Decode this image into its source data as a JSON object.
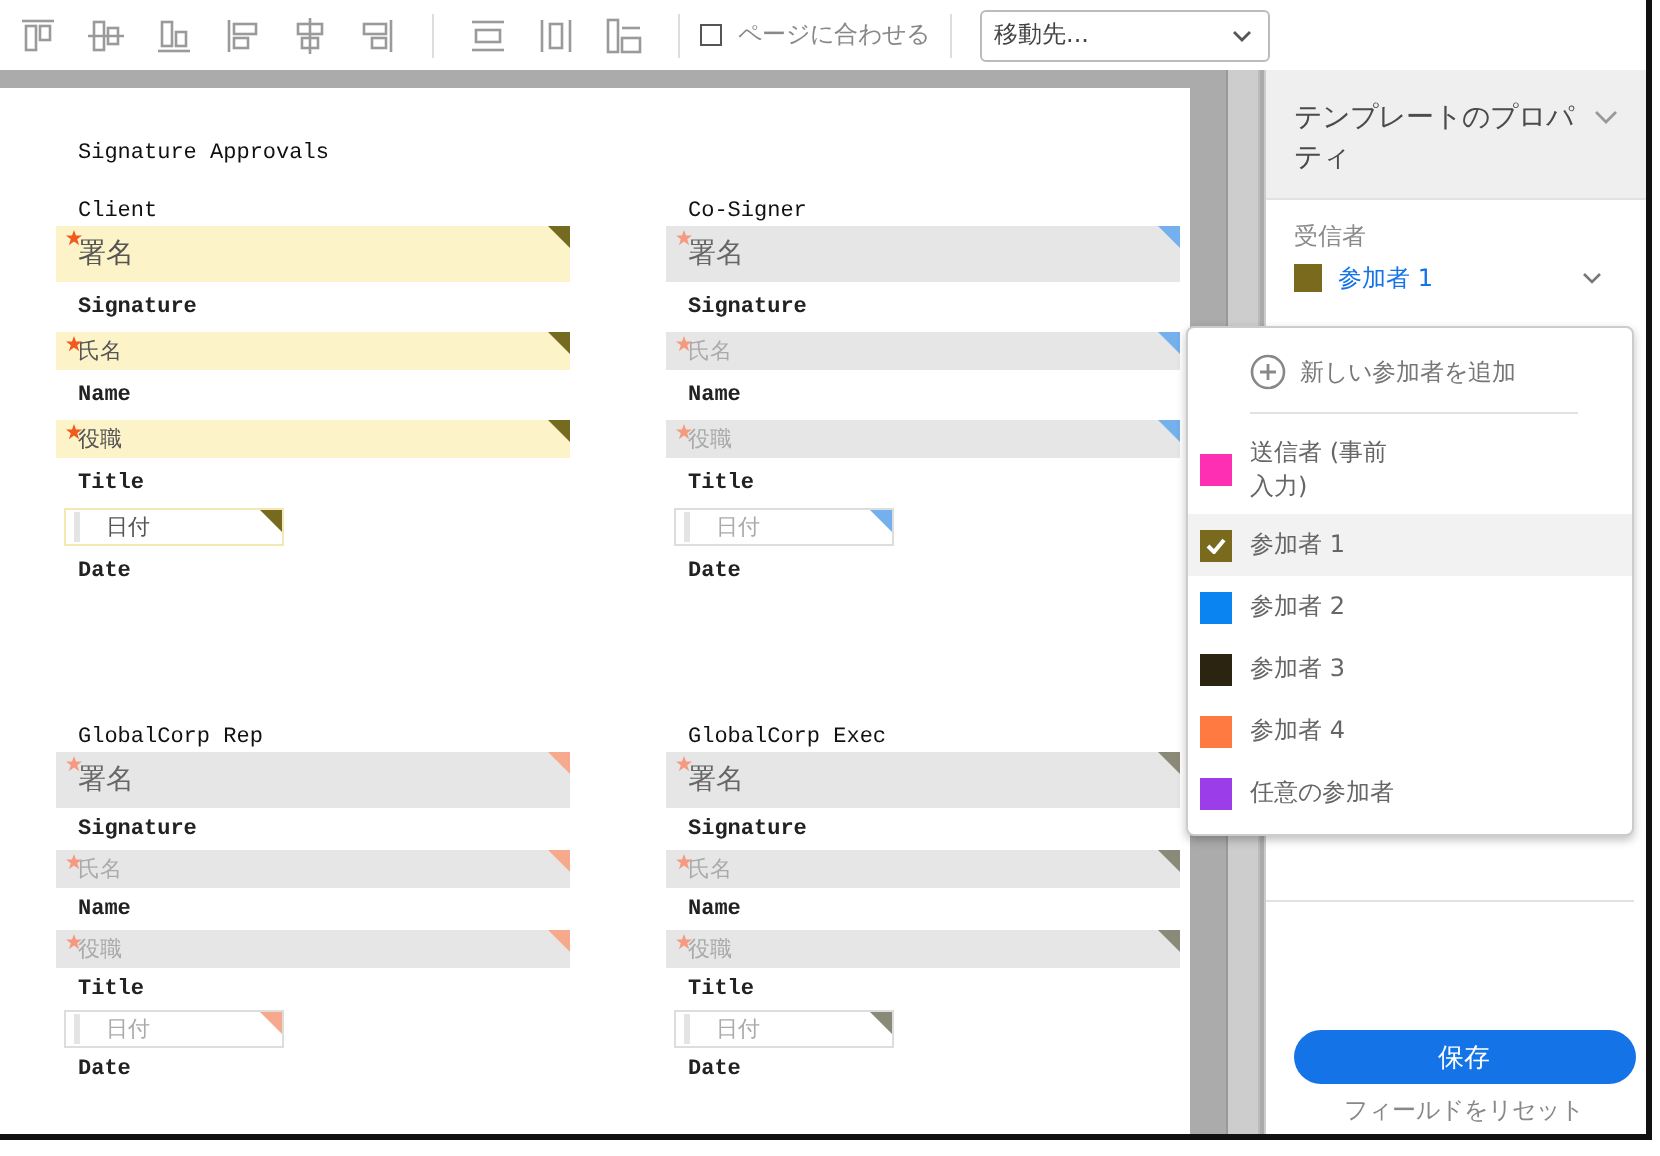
{
  "toolbar": {
    "fit_page": {
      "label": "ページに合わせる",
      "checked": false
    },
    "goto": {
      "value": "移動先..."
    }
  },
  "document": {
    "title": "Signature Approvals",
    "rows": [
      {
        "sections": [
          {
            "heading": "Client",
            "color": "#756a1f",
            "highlighted": true,
            "fields": [
              {
                "kind": "signature",
                "placeholder": "署名",
                "required": true,
                "caption": "Signature"
              },
              {
                "kind": "text",
                "placeholder": "氏名",
                "required": true,
                "caption": "Name"
              },
              {
                "kind": "text",
                "placeholder": "役職",
                "required": true,
                "caption": "Title"
              },
              {
                "kind": "date",
                "placeholder": "日付",
                "required": false,
                "caption": "Date"
              }
            ]
          },
          {
            "heading": "Co-Signer",
            "color": "#74b0ec",
            "highlighted": false,
            "fields": [
              {
                "kind": "signature",
                "placeholder": "署名",
                "required": true,
                "caption": "Signature"
              },
              {
                "kind": "text",
                "placeholder": "氏名",
                "required": true,
                "caption": "Name"
              },
              {
                "kind": "text",
                "placeholder": "役職",
                "required": true,
                "caption": "Title"
              },
              {
                "kind": "date",
                "placeholder": "日付",
                "required": false,
                "caption": "Date"
              }
            ]
          }
        ]
      },
      {
        "sections": [
          {
            "heading": "GlobalCorp Rep",
            "color": "#f6a98c",
            "highlighted": false,
            "fields": [
              {
                "kind": "signature",
                "placeholder": "署名",
                "required": true,
                "caption": "Signature"
              },
              {
                "kind": "text",
                "placeholder": "氏名",
                "required": true,
                "caption": "Name"
              },
              {
                "kind": "text",
                "placeholder": "役職",
                "required": true,
                "caption": "Title"
              },
              {
                "kind": "date",
                "placeholder": "日付",
                "required": false,
                "caption": "Date"
              }
            ]
          },
          {
            "heading": "GlobalCorp Exec",
            "color": "#8b8a78",
            "highlighted": false,
            "fields": [
              {
                "kind": "signature",
                "placeholder": "署名",
                "required": true,
                "caption": "Signature"
              },
              {
                "kind": "text",
                "placeholder": "氏名",
                "required": true,
                "caption": "Name"
              },
              {
                "kind": "text",
                "placeholder": "役職",
                "required": true,
                "caption": "Title"
              },
              {
                "kind": "date",
                "placeholder": "日付",
                "required": false,
                "caption": "Date"
              }
            ]
          }
        ]
      }
    ]
  },
  "panel": {
    "title": "テンプレートのプロパティ",
    "recipient_label": "受信者",
    "recipient": {
      "label": "参加者 1",
      "color": "#7a6a1e"
    },
    "save": "保存",
    "reset": "フィールドをリセット"
  },
  "menu": {
    "add": "新しい参加者を追加",
    "items": [
      {
        "label": "送信者 (事前入力)",
        "color": "#ff2fb4",
        "selected": false
      },
      {
        "label": "参加者 1",
        "color": "#7a6a1e",
        "selected": true
      },
      {
        "label": "参加者 2",
        "color": "#0a84f0",
        "selected": false
      },
      {
        "label": "参加者 3",
        "color": "#2a2410",
        "selected": false
      },
      {
        "label": "参加者 4",
        "color": "#ff7a40",
        "selected": false
      },
      {
        "label": "任意の参加者",
        "color": "#9b3de8",
        "selected": false
      }
    ]
  }
}
